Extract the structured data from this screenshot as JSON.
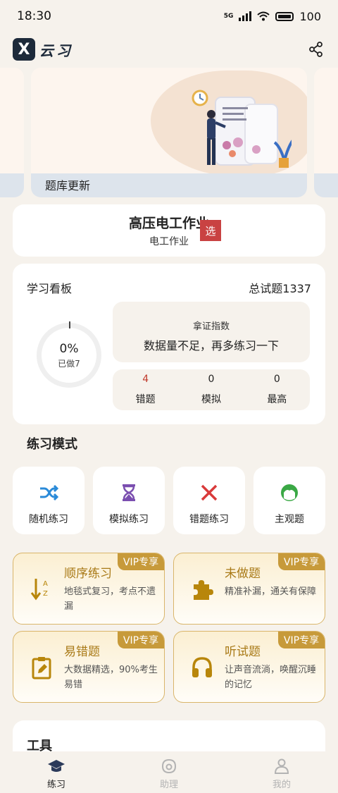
{
  "status": {
    "time": "18:30",
    "network": "5G",
    "battery": "100"
  },
  "header": {
    "logo_mark": "X",
    "logo_text": "云习"
  },
  "banner": {
    "label": "题库更新"
  },
  "subject": {
    "title": "高压电工作业",
    "subtitle": "电工作业",
    "select_label": "选"
  },
  "board": {
    "title": "学习看板",
    "total": "总试题1337",
    "progress_pct": "0%",
    "done_label": "已做7",
    "index_label": "拿证指数",
    "index_message": "数据量不足，再多练习一下",
    "stats": [
      {
        "value": "4",
        "label": "错题"
      },
      {
        "value": "0",
        "label": "模拟"
      },
      {
        "value": "0",
        "label": "最高"
      }
    ]
  },
  "practice": {
    "title": "练习模式",
    "modes": [
      {
        "label": "随机练习",
        "icon": "shuffle-icon"
      },
      {
        "label": "模拟练习",
        "icon": "hourglass-icon"
      },
      {
        "label": "错题练习",
        "icon": "close-icon"
      },
      {
        "label": "主观题",
        "icon": "face-icon"
      }
    ],
    "vip_cards": [
      {
        "tag": "VIP专享",
        "title": "顺序练习",
        "desc": "地毯式复习，考点不遗漏",
        "icon": "sort-az-icon"
      },
      {
        "tag": "VIP专享",
        "title": "未做题",
        "desc": "精准补漏，通关有保障",
        "icon": "puzzle-icon"
      },
      {
        "tag": "VIP专享",
        "title": "易错题",
        "desc": "大数据精选，90%考生易错",
        "icon": "clipboard-edit-icon"
      },
      {
        "tag": "VIP专享",
        "title": "听试题",
        "desc": "让声音流淌，唤醒沉睡的记忆",
        "icon": "headphones-icon"
      }
    ]
  },
  "tools": {
    "title": "工具"
  },
  "tabs": [
    {
      "label": "练习"
    },
    {
      "label": "助理"
    },
    {
      "label": "我的"
    }
  ],
  "colors": {
    "accent_gold": "#c79a3a",
    "error_red": "#c94242",
    "mode_blue": "#2a8ad8",
    "mode_purple": "#7b4fb0",
    "mode_green": "#3aa845"
  }
}
